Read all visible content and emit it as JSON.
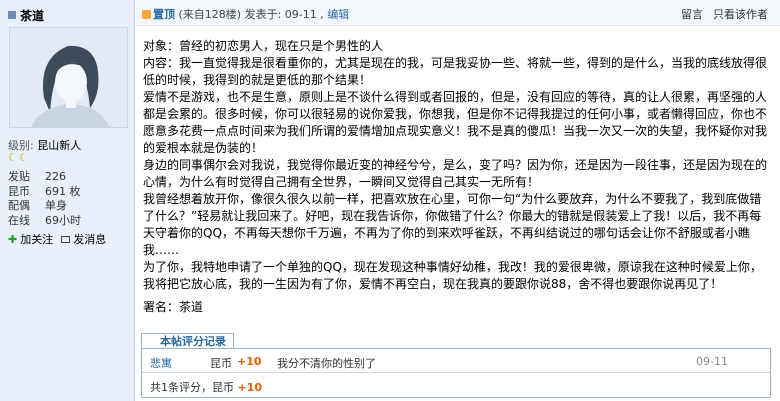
{
  "user": {
    "name": "茶道",
    "level_label": "级别:",
    "level_name": "昆山新人",
    "moons": "☾☾",
    "stats": [
      {
        "key": "发贴",
        "value": "226"
      },
      {
        "key": "昆币",
        "value": "691 枚"
      },
      {
        "key": "配偶",
        "value": "单身"
      },
      {
        "key": "在线",
        "value": "69小时"
      }
    ],
    "actions": {
      "follow": "加关注",
      "message": "发消息"
    }
  },
  "post": {
    "top_tag": "置顶",
    "floor": "(来自128楼)",
    "posted": "发表于: 09-11 ,",
    "edit": "编辑",
    "tools": {
      "reply": "留言",
      "only_author": "只看该作者"
    },
    "lines": [
      "对象：曾经的初恋男人，现在只是个男性的人",
      "内容：我一直觉得我是很看重你的，尤其是现在的我，可是我妥协一些、将就一些，得到的是什么，当我的底线放得很低的时候，我得到的就是更低的那个结果！",
      "爱情不是游戏，也不是生意，原则上是不谈什么得到或者回报的，但是，没有回应的等待，真的让人很累，再坚强的人都是会累的。很多时候，你可以很轻易的说你爱我，你想我，但是你不记得我提过的任何小事，或者懒得回应，你也不愿意多花费一点点时间来为我们所谓的爱情增加点现实意义！我不是真的傻瓜！当我一次又一次的失望，我怀疑你对我的爱根本就是伪装的！",
      "身边的同事偶尔会对我说，我觉得你最近变的神经兮兮，是么，变了吗？因为你，还是因为一段往事，还是因为现在的心情，为什么有时觉得自己拥有全世界，一瞬间又觉得自己其实一无所有！",
      "我曾经想着放开你，像很久很久以前一样，把喜欢放在心里，可你一句“为什么要放弃，为什么不要我了，我到底做错了什么？”轻易就让我回来了。好吧，现在我告诉你，你做错了什么？你最大的错就是假装爱上了我！以后，我不再每天守着你的QQ，不再每天想你千万遍，不再为了你的到来欢呼雀跃，不再纠结说过的哪句话会让你不舒服或者小瞧我……",
      "为了你，我特地申请了一个单独的QQ，现在发现这种事情好幼稚，我改！我的爱很卑微，原谅我在这种时候爱上你，我将把它放心底，我的一生因为有了你，爱情不再空白，现在我真的要跟你说88，舍不得也要跟你说再见了！"
    ],
    "signature": "署名：茶道"
  },
  "rating": {
    "title": "本帖评分记录",
    "rows": [
      {
        "user": "悲寓",
        "currency": "昆币",
        "amount": "+10",
        "reason": "我分不清你的性别了",
        "date": "09-11"
      }
    ],
    "total_prefix": "共1条评分，昆币",
    "total_amount": "+10"
  }
}
